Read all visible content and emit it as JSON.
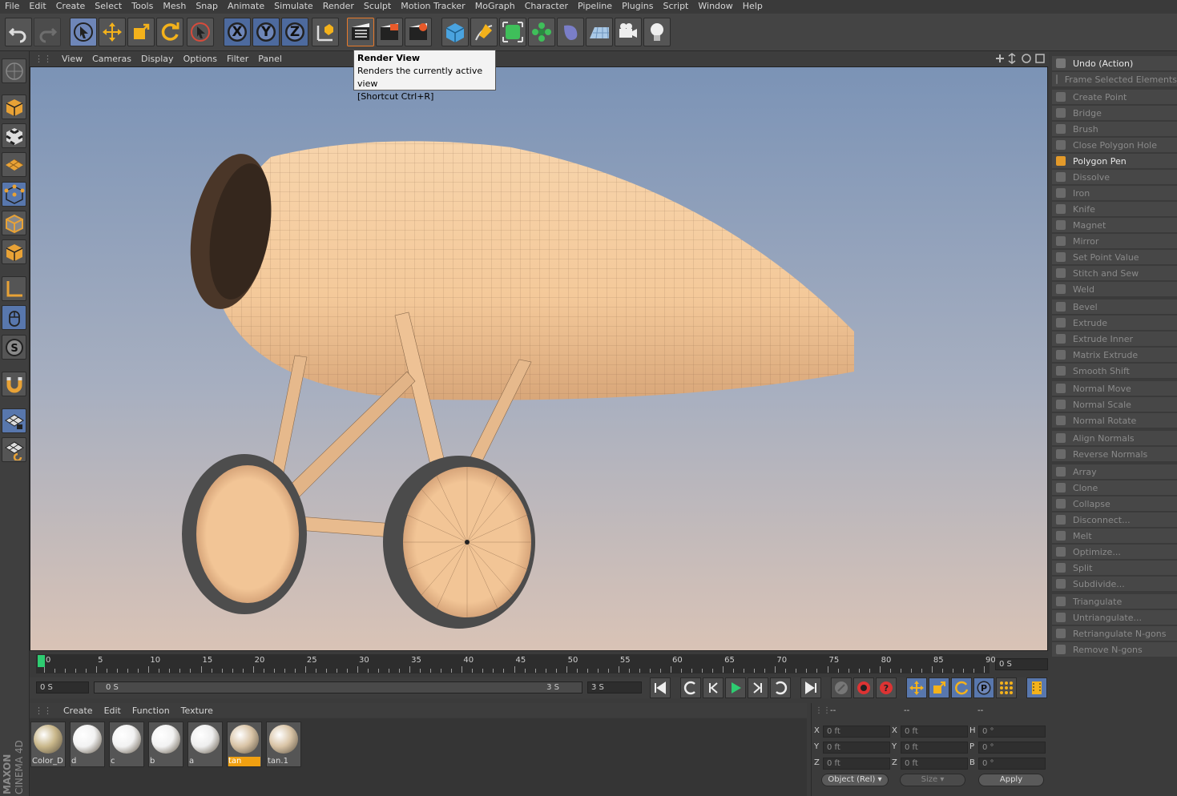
{
  "menubar": [
    "File",
    "Edit",
    "Create",
    "Select",
    "Tools",
    "Mesh",
    "Snap",
    "Animate",
    "Simulate",
    "Render",
    "Sculpt",
    "Motion Tracker",
    "MoGraph",
    "Character",
    "Pipeline",
    "Plugins",
    "Script",
    "Window",
    "Help"
  ],
  "toolbar": {
    "icons": [
      "undo-icon",
      "redo-icon",
      "live-selection-icon",
      "move-icon",
      "scale-icon",
      "rotate-icon",
      "recent-tool-icon",
      "x-axis-lock-icon",
      "y-axis-lock-icon",
      "z-axis-lock-icon",
      "coordinate-system-icon",
      "render-view-icon",
      "render-picture-viewer-icon",
      "render-settings-icon",
      "cube-icon",
      "pen-spline-icon",
      "subdivision-surface-icon",
      "cloner-icon",
      "deformer-icon",
      "floor-icon",
      "camera-icon",
      "light-icon"
    ],
    "labels": {
      "x": "X",
      "y": "Y",
      "z": "Z"
    }
  },
  "tooltip": {
    "title": "Render View",
    "description": "Renders the currently active view",
    "shortcut": "[Shortcut Ctrl+R]"
  },
  "viewport": {
    "menu": [
      "View",
      "Cameras",
      "Display",
      "Options",
      "Filter",
      "Panel"
    ],
    "colors": {
      "sky_top": "#7b93b6",
      "sky_bottom": "#d9c3b6",
      "model": "#f4c99a"
    }
  },
  "right_panel": {
    "items": [
      {
        "label": "Undo (Action)",
        "enabled": true
      },
      {
        "label": "Frame Selected Elements",
        "enabled": false
      },
      {
        "label": "Create Point",
        "enabled": false
      },
      {
        "label": "Bridge",
        "enabled": false
      },
      {
        "label": "Brush",
        "enabled": false
      },
      {
        "label": "Close Polygon Hole",
        "enabled": false
      },
      {
        "label": "Polygon Pen",
        "enabled": true
      },
      {
        "label": "Dissolve",
        "enabled": false
      },
      {
        "label": "Iron",
        "enabled": false
      },
      {
        "label": "Knife",
        "enabled": false
      },
      {
        "label": "Magnet",
        "enabled": false
      },
      {
        "label": "Mirror",
        "enabled": false
      },
      {
        "label": "Set Point Value",
        "enabled": false
      },
      {
        "label": "Stitch and Sew",
        "enabled": false
      },
      {
        "label": "Weld",
        "enabled": false
      },
      {
        "label": "Bevel",
        "enabled": false
      },
      {
        "label": "Extrude",
        "enabled": false
      },
      {
        "label": "Extrude Inner",
        "enabled": false
      },
      {
        "label": "Matrix Extrude",
        "enabled": false
      },
      {
        "label": "Smooth Shift",
        "enabled": false
      },
      {
        "label": "Normal Move",
        "enabled": false
      },
      {
        "label": "Normal Scale",
        "enabled": false
      },
      {
        "label": "Normal Rotate",
        "enabled": false
      },
      {
        "label": "Align Normals",
        "enabled": false
      },
      {
        "label": "Reverse Normals",
        "enabled": false
      },
      {
        "label": "Array",
        "enabled": false
      },
      {
        "label": "Clone",
        "enabled": false
      },
      {
        "label": "Collapse",
        "enabled": false
      },
      {
        "label": "Disconnect...",
        "enabled": false
      },
      {
        "label": "Melt",
        "enabled": false
      },
      {
        "label": "Optimize...",
        "enabled": false
      },
      {
        "label": "Split",
        "enabled": false
      },
      {
        "label": "Subdivide...",
        "enabled": false
      },
      {
        "label": "Triangulate",
        "enabled": false
      },
      {
        "label": "Untriangulate...",
        "enabled": false
      },
      {
        "label": "Retriangulate N-gons",
        "enabled": false
      },
      {
        "label": "Remove N-gons",
        "enabled": false
      }
    ]
  },
  "timeline": {
    "ticks": [
      "0",
      "5",
      "10",
      "15",
      "20",
      "25",
      "30",
      "35",
      "40",
      "45",
      "50",
      "55",
      "60",
      "65",
      "70",
      "75",
      "80",
      "85",
      "90"
    ],
    "current_frame_field": "0 S",
    "start_field": "0 S",
    "range_start": "0 S",
    "range_end": "3 S",
    "end_field": "3 S"
  },
  "materials": {
    "menu": [
      "Create",
      "Edit",
      "Function",
      "Texture"
    ],
    "items": [
      {
        "name": "Color_D",
        "color": "#c9b78a",
        "selected": false
      },
      {
        "name": "d",
        "color": "#f2f2f2",
        "selected": false
      },
      {
        "name": "c",
        "color": "#f2f2f2",
        "selected": false
      },
      {
        "name": "b",
        "color": "#f2f2f2",
        "selected": false
      },
      {
        "name": "a",
        "color": "#eeeeee",
        "selected": false
      },
      {
        "name": "tan",
        "color": "#d9c4a6",
        "selected": true
      },
      {
        "name": "tan.1",
        "color": "#d9c4a6",
        "selected": false
      }
    ]
  },
  "coordinates": {
    "headers": [
      "--",
      "--",
      "--"
    ],
    "rows": [
      {
        "l1": "X",
        "v1": "0 ft",
        "l2": "X",
        "v2": "0 ft",
        "l3": "H",
        "v3": "0 °"
      },
      {
        "l1": "Y",
        "v1": "0 ft",
        "l2": "Y",
        "v2": "0 ft",
        "l3": "P",
        "v3": "0 °"
      },
      {
        "l1": "Z",
        "v1": "0 ft",
        "l2": "Z",
        "v2": "0 ft",
        "l3": "B",
        "v3": "0 °"
      }
    ],
    "mode": "Object (Rel)",
    "size_mode": "Size",
    "apply": "Apply"
  },
  "logo": {
    "line1": "MAXON",
    "line2": "CINEMA 4D"
  }
}
